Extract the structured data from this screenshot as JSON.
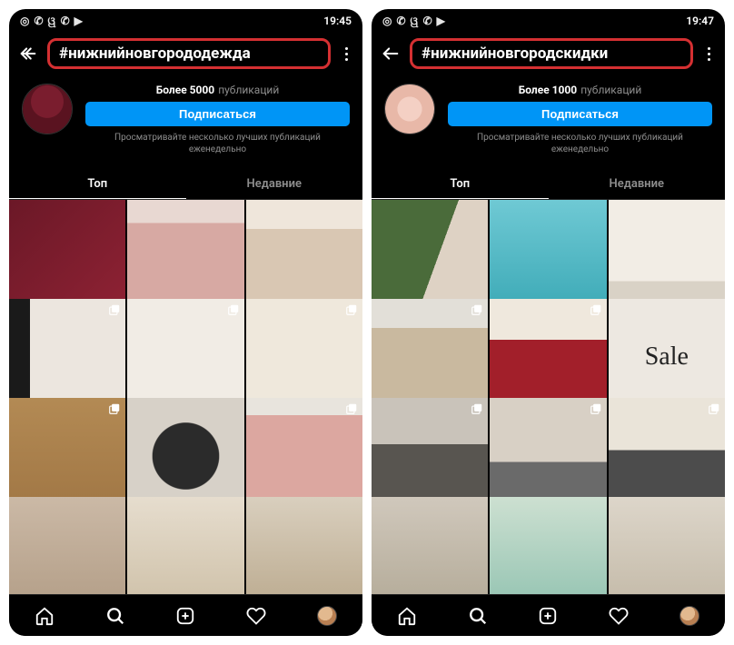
{
  "screens": [
    {
      "status": {
        "time": "19:45",
        "icons": [
          "instagram",
          "viber",
          "odnoklassniki",
          "viber2",
          "play"
        ]
      },
      "hashtag": "#нижнийновгородо­дежда",
      "hashtag_plain": "#нижнийновгородо дежда",
      "hashtag_raw": "#нижнийновгородо­дежда",
      "count_prefix": "Более 5000",
      "count_label": "публикаций",
      "follow_label": "Подписаться",
      "hint": "Просматривайте несколько лучших публикаций еженедельно",
      "tabs": {
        "top": "Топ",
        "recent": "Недавние"
      },
      "tiles": [
        {
          "cls": "t-burgundy",
          "multi": false
        },
        {
          "cls": "t-pink-ts",
          "multi": false
        },
        {
          "cls": "t-beige-ts",
          "multi": false
        },
        {
          "cls": "t-white-coat",
          "multi": true
        },
        {
          "cls": "t-beige-dress",
          "multi": true
        },
        {
          "cls": "t-cream",
          "multi": true
        },
        {
          "cls": "t-camel",
          "multi": true
        },
        {
          "cls": "t-jacket",
          "multi": false
        },
        {
          "cls": "t-pink2",
          "multi": true
        },
        {
          "cls": "t-row4a",
          "multi": false
        },
        {
          "cls": "t-row4b",
          "multi": false
        },
        {
          "cls": "t-row4c",
          "multi": false
        }
      ],
      "hashtag_text": "#нижнийновгородо­дежда"
    },
    {
      "status": {
        "time": "19:47",
        "icons": [
          "instagram",
          "viber",
          "odnoklassniki",
          "viber2",
          "play"
        ]
      },
      "hashtag_text": "#нижнийновгородскидки",
      "count_prefix": "Более 1000",
      "count_label": "публикаций",
      "follow_label": "Подписаться",
      "hint": "Просматривайте несколько лучших публикаций еженедельно",
      "tabs": {
        "top": "Топ",
        "recent": "Недавние"
      },
      "tiles": [
        {
          "cls": "t-products",
          "multi": false
        },
        {
          "cls": "t-aqua",
          "multi": false
        },
        {
          "cls": "t-store",
          "multi": false
        },
        {
          "cls": "t-mask",
          "multi": true
        },
        {
          "cls": "t-redsofa",
          "multi": true
        },
        {
          "cls": "t-sale",
          "multi": false,
          "text": "Sale"
        },
        {
          "cls": "t-greysofa",
          "multi": true
        },
        {
          "cls": "t-livingroom",
          "multi": true
        },
        {
          "cls": "t-kitchen",
          "multi": true
        },
        {
          "cls": "t-r4a",
          "multi": false
        },
        {
          "cls": "t-r4b",
          "multi": false
        },
        {
          "cls": "t-r4c",
          "multi": false
        }
      ]
    }
  ],
  "hashtags": {
    "left": "#нижнийновгородо­дежда",
    "right": "#нижнийновгородскидки"
  },
  "hashtag_left": "#нижнийновгородо­дежда",
  "hashtag_left_full": "#нижнийновгородо дежда",
  "nav": {
    "home": "home",
    "search": "search",
    "create": "create",
    "activity": "activity",
    "profile": "profile"
  }
}
